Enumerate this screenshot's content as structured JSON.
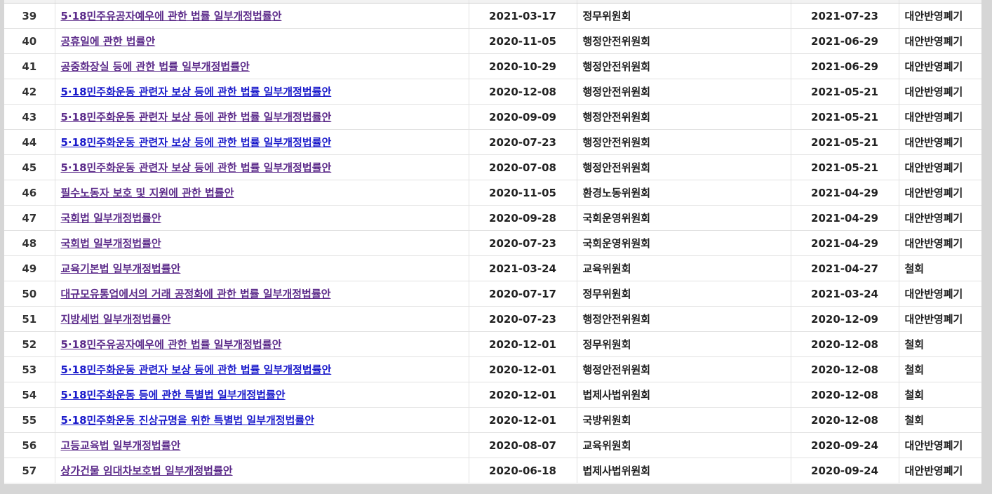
{
  "colors": {
    "visited_link": "#5c2b8a",
    "unvisited_link": "#1a1acb",
    "row_border": "#e2e2e2",
    "page_background": "#d6d6d6"
  },
  "rows": [
    {
      "num": "39",
      "title": "5·18민주유공자예우에 관한 법률 일부개정법률안",
      "proposed": "2021-03-17",
      "committee": "정무위원회",
      "processed": "2021-07-23",
      "result": "대안반영폐기",
      "link_state": "visited"
    },
    {
      "num": "40",
      "title": "공휴일에 관한 법률안",
      "proposed": "2020-11-05",
      "committee": "행정안전위원회",
      "processed": "2021-06-29",
      "result": "대안반영폐기",
      "link_state": "visited"
    },
    {
      "num": "41",
      "title": "공중화장실 등에 관한 법률 일부개정법률안",
      "proposed": "2020-10-29",
      "committee": "행정안전위원회",
      "processed": "2021-06-29",
      "result": "대안반영폐기",
      "link_state": "visited"
    },
    {
      "num": "42",
      "title": "5·18민주화운동 관련자 보상 등에 관한 법률 일부개정법률안",
      "proposed": "2020-12-08",
      "committee": "행정안전위원회",
      "processed": "2021-05-21",
      "result": "대안반영폐기",
      "link_state": "unvisited"
    },
    {
      "num": "43",
      "title": "5·18민주화운동 관련자 보상 등에 관한 법률 일부개정법률안",
      "proposed": "2020-09-09",
      "committee": "행정안전위원회",
      "processed": "2021-05-21",
      "result": "대안반영폐기",
      "link_state": "visited"
    },
    {
      "num": "44",
      "title": "5·18민주화운동 관련자 보상 등에 관한 법률 일부개정법률안",
      "proposed": "2020-07-23",
      "committee": "행정안전위원회",
      "processed": "2021-05-21",
      "result": "대안반영폐기",
      "link_state": "unvisited"
    },
    {
      "num": "45",
      "title": "5·18민주화운동 관련자 보상 등에 관한 법률 일부개정법률안",
      "proposed": "2020-07-08",
      "committee": "행정안전위원회",
      "processed": "2021-05-21",
      "result": "대안반영폐기",
      "link_state": "visited"
    },
    {
      "num": "46",
      "title": "필수노동자 보호 및 지원에 관한 법률안",
      "proposed": "2020-11-05",
      "committee": "환경노동위원회",
      "processed": "2021-04-29",
      "result": "대안반영폐기",
      "link_state": "visited"
    },
    {
      "num": "47",
      "title": "국회법 일부개정법률안",
      "proposed": "2020-09-28",
      "committee": "국회운영위원회",
      "processed": "2021-04-29",
      "result": "대안반영폐기",
      "link_state": "visited"
    },
    {
      "num": "48",
      "title": "국회법 일부개정법률안",
      "proposed": "2020-07-23",
      "committee": "국회운영위원회",
      "processed": "2021-04-29",
      "result": "대안반영폐기",
      "link_state": "visited"
    },
    {
      "num": "49",
      "title": "교육기본법 일부개정법률안",
      "proposed": "2021-03-24",
      "committee": "교육위원회",
      "processed": "2021-04-27",
      "result": "철회",
      "link_state": "visited"
    },
    {
      "num": "50",
      "title": "대규모유통업에서의 거래 공정화에 관한 법률 일부개정법률안",
      "proposed": "2020-07-17",
      "committee": "정무위원회",
      "processed": "2021-03-24",
      "result": "대안반영폐기",
      "link_state": "visited"
    },
    {
      "num": "51",
      "title": "지방세법 일부개정법률안",
      "proposed": "2020-07-23",
      "committee": "행정안전위원회",
      "processed": "2020-12-09",
      "result": "대안반영폐기",
      "link_state": "visited"
    },
    {
      "num": "52",
      "title": "5·18민주유공자예우에 관한 법률 일부개정법률안",
      "proposed": "2020-12-01",
      "committee": "정무위원회",
      "processed": "2020-12-08",
      "result": "철회",
      "link_state": "visited"
    },
    {
      "num": "53",
      "title": "5·18민주화운동 관련자 보상 등에 관한 법률 일부개정법률안",
      "proposed": "2020-12-01",
      "committee": "행정안전위원회",
      "processed": "2020-12-08",
      "result": "철회",
      "link_state": "unvisited"
    },
    {
      "num": "54",
      "title": "5·18민주화운동 등에 관한 특별법 일부개정법률안",
      "proposed": "2020-12-01",
      "committee": "법제사법위원회",
      "processed": "2020-12-08",
      "result": "철회",
      "link_state": "unvisited"
    },
    {
      "num": "55",
      "title": "5·18민주화운동 진상규명을 위한 특별법 일부개정법률안",
      "proposed": "2020-12-01",
      "committee": "국방위원회",
      "processed": "2020-12-08",
      "result": "철회",
      "link_state": "unvisited"
    },
    {
      "num": "56",
      "title": "고등교육법 일부개정법률안",
      "proposed": "2020-08-07",
      "committee": "교육위원회",
      "processed": "2020-09-24",
      "result": "대안반영폐기",
      "link_state": "visited"
    },
    {
      "num": "57",
      "title": "상가건물 임대차보호법 일부개정법률안",
      "proposed": "2020-06-18",
      "committee": "법제사법위원회",
      "processed": "2020-09-24",
      "result": "대안반영폐기",
      "link_state": "visited"
    }
  ]
}
